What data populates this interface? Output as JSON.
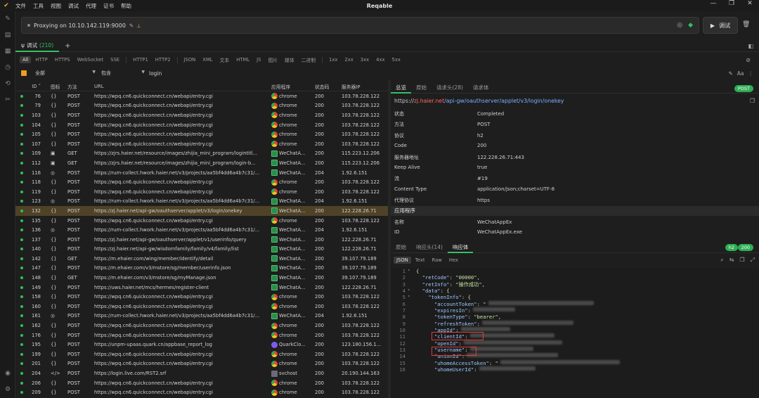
{
  "window": {
    "title": "Reqable",
    "menu": [
      "文件",
      "工具",
      "视图",
      "调试",
      "代理",
      "证书",
      "帮助"
    ]
  },
  "proxy": {
    "status": "Proxying on 10.10.142.119:9000",
    "debug_label": "调试"
  },
  "session_tab": {
    "label": "调试",
    "count": "(210)"
  },
  "filters": [
    "All",
    "HTTP",
    "HTTPS",
    "WebSocket",
    "SSE",
    "HTTP1",
    "HTTP2",
    "JSON",
    "XML",
    "文本",
    "HTML",
    "JS",
    "图片",
    "媒体",
    "二进制",
    "1xx",
    "2xx",
    "3xx",
    "4xx",
    "5xx"
  ],
  "search": {
    "scope": "全部",
    "mode": "包含",
    "keyword": "login"
  },
  "table": {
    "headers": {
      "id": "ID",
      "icon": "图标",
      "method": "方法",
      "url": "URL",
      "app": "应用程序",
      "status": "状态码",
      "ip": "服务器IP"
    },
    "selected_id": "132",
    "rows": [
      {
        "id": "76",
        "icon": "{}",
        "method": "POST",
        "url": "https://wpq.cn6.quickconnect.cn/webapi/entry.cgi",
        "app": "chrome",
        "appType": "chrome",
        "status": "200",
        "ip": "103.78.228.122"
      },
      {
        "id": "79",
        "icon": "{}",
        "method": "POST",
        "url": "https://wpq.cn6.quickconnect.cn/webapi/entry.cgi",
        "app": "chrome",
        "appType": "chrome",
        "status": "200",
        "ip": "103.78.228.122"
      },
      {
        "id": "103",
        "icon": "{}",
        "method": "POST",
        "url": "https://wpq.cn6.quickconnect.cn/webapi/entry.cgi",
        "app": "chrome",
        "appType": "chrome",
        "status": "200",
        "ip": "103.78.228.122"
      },
      {
        "id": "104",
        "icon": "{}",
        "method": "POST",
        "url": "https://wpq.cn6.quickconnect.cn/webapi/entry.cgi",
        "app": "chrome",
        "appType": "chrome",
        "status": "200",
        "ip": "103.78.228.122"
      },
      {
        "id": "105",
        "icon": "{}",
        "method": "POST",
        "url": "https://wpq.cn6.quickconnect.cn/webapi/entry.cgi",
        "app": "chrome",
        "appType": "chrome",
        "status": "200",
        "ip": "103.78.228.122"
      },
      {
        "id": "107",
        "icon": "{}",
        "method": "POST",
        "url": "https://wpq.cn6.quickconnect.cn/webapi/entry.cgi",
        "app": "chrome",
        "appType": "chrome",
        "status": "200",
        "ip": "103.78.228.122"
      },
      {
        "id": "109",
        "icon": "▣",
        "method": "GET",
        "url": "https://zjrs.haier.net/resource/images/zhijia_mini_program/logintitl...",
        "app": "WeChatA...",
        "appType": "wechat",
        "status": "200",
        "ip": "115.223.12.206"
      },
      {
        "id": "112",
        "icon": "▣",
        "method": "GET",
        "url": "https://zjrs.haier.net/resource/images/zhijia_mini_program/login-b...",
        "app": "WeChatA...",
        "appType": "wechat",
        "status": "200",
        "ip": "115.223.12.206"
      },
      {
        "id": "116",
        "icon": "◎",
        "method": "POST",
        "url": "https://rum-collect.hwork.haier.net/v3/projects/aa5bf4dd6a4b7c31/...",
        "app": "WeChatA...",
        "appType": "wechat",
        "status": "204",
        "ip": "1.92.6.151"
      },
      {
        "id": "118",
        "icon": "{}",
        "method": "POST",
        "url": "https://wpq.cn6.quickconnect.cn/webapi/entry.cgi",
        "app": "chrome",
        "appType": "chrome",
        "status": "200",
        "ip": "103.78.228.122"
      },
      {
        "id": "119",
        "icon": "{}",
        "method": "POST",
        "url": "https://wpq.cn6.quickconnect.cn/webapi/entry.cgi",
        "app": "chrome",
        "appType": "chrome",
        "status": "200",
        "ip": "103.78.228.122"
      },
      {
        "id": "123",
        "icon": "◎",
        "method": "POST",
        "url": "https://rum-collect.hwork.haier.net/v3/projects/aa5bf4dd6a4b7c31/...",
        "app": "WeChatA...",
        "appType": "wechat",
        "status": "204",
        "ip": "1.92.6.151"
      },
      {
        "id": "132",
        "icon": "{}",
        "method": "POST",
        "url": "https://zj.haier.net/api-gw/oauthserver/applet/v3/login/onekey",
        "app": "WeChatA...",
        "appType": "wechat",
        "status": "200",
        "ip": "122.228.26.71"
      },
      {
        "id": "135",
        "icon": "{}",
        "method": "POST",
        "url": "https://wpq.cn6.quickconnect.cn/webapi/entry.cgi",
        "app": "chrome",
        "appType": "chrome",
        "status": "200",
        "ip": "103.78.228.122"
      },
      {
        "id": "136",
        "icon": "◎",
        "method": "POST",
        "url": "https://rum-collect.hwork.haier.net/v3/projects/aa5bf4dd6a4b7c31/...",
        "app": "WeChatA...",
        "appType": "wechat",
        "status": "204",
        "ip": "1.92.6.151"
      },
      {
        "id": "137",
        "icon": "{}",
        "method": "POST",
        "url": "https://zj.haier.net/api-gw/oauthserver/applet/v1/userinfo/query",
        "app": "WeChatA...",
        "appType": "wechat",
        "status": "200",
        "ip": "122.228.26.71"
      },
      {
        "id": "140",
        "icon": "{}",
        "method": "POST",
        "url": "https://zj.haier.net/api-gw/wisdomfamily/family/v4/family/list",
        "app": "WeChatA...",
        "appType": "wechat",
        "status": "200",
        "ip": "122.228.26.71"
      },
      {
        "id": "142",
        "icon": "{}",
        "method": "GET",
        "url": "https://m.ehaier.com/wing/member/identify/detail",
        "app": "WeChatA...",
        "appType": "wechat",
        "status": "200",
        "ip": "39.107.79.189"
      },
      {
        "id": "147",
        "icon": "{}",
        "method": "POST",
        "url": "https://m.ehaier.com/v3/mstore/sg/member/userinfo.json",
        "app": "WeChatA...",
        "appType": "wechat",
        "status": "200",
        "ip": "39.107.79.189"
      },
      {
        "id": "148",
        "icon": "{}",
        "method": "GET",
        "url": "https://m.ehaier.com/v3/mstore/sg/myManage.json",
        "app": "WeChatA...",
        "appType": "wechat",
        "status": "200",
        "ip": "39.107.79.189"
      },
      {
        "id": "149",
        "icon": "{}",
        "method": "POST",
        "url": "https://uws.haier.net/mcs/hermes/register-client",
        "app": "WeChatA...",
        "appType": "wechat",
        "status": "200",
        "ip": "122.228.26.71"
      },
      {
        "id": "158",
        "icon": "{}",
        "method": "POST",
        "url": "https://wpq.cn6.quickconnect.cn/webapi/entry.cgi",
        "app": "chrome",
        "appType": "chrome",
        "status": "200",
        "ip": "103.78.228.122"
      },
      {
        "id": "160",
        "icon": "{}",
        "method": "POST",
        "url": "https://wpq.cn6.quickconnect.cn/webapi/entry.cgi",
        "app": "chrome",
        "appType": "chrome",
        "status": "200",
        "ip": "103.78.228.122"
      },
      {
        "id": "161",
        "icon": "◎",
        "method": "POST",
        "url": "https://rum-collect.hwork.haier.net/v3/projects/aa5bf4dd6a4b7c31/...",
        "app": "WeChatA...",
        "appType": "wechat",
        "status": "204",
        "ip": "1.92.6.151"
      },
      {
        "id": "162",
        "icon": "{}",
        "method": "POST",
        "url": "https://wpq.cn6.quickconnect.cn/webapi/entry.cgi",
        "app": "chrome",
        "appType": "chrome",
        "status": "200",
        "ip": "103.78.228.122"
      },
      {
        "id": "176",
        "icon": "{}",
        "method": "POST",
        "url": "https://wpq.cn6.quickconnect.cn/webapi/entry.cgi",
        "app": "chrome",
        "appType": "chrome",
        "status": "200",
        "ip": "103.78.228.122"
      },
      {
        "id": "195",
        "icon": "{}",
        "method": "POST",
        "url": "https://unpm-upaas.quark.cn/appbase_report_log",
        "app": "QuarkClo...",
        "appType": "quark",
        "status": "200",
        "ip": "123.180.156.1..."
      },
      {
        "id": "199",
        "icon": "{}",
        "method": "POST",
        "url": "https://wpq.cn6.quickconnect.cn/webapi/entry.cgi",
        "app": "chrome",
        "appType": "chrome",
        "status": "200",
        "ip": "103.78.228.122"
      },
      {
        "id": "201",
        "icon": "{}",
        "method": "POST",
        "url": "https://wpq.cn6.quickconnect.cn/webapi/entry.cgi",
        "app": "chrome",
        "appType": "chrome",
        "status": "200",
        "ip": "103.78.228.122"
      },
      {
        "id": "204",
        "icon": "</>",
        "method": "POST",
        "url": "https://login.live.com/RST2.srf",
        "app": "svchost",
        "appType": "svc",
        "status": "200",
        "ip": "20.190.144.163"
      },
      {
        "id": "206",
        "icon": "{}",
        "method": "POST",
        "url": "https://wpq.cn6.quickconnect.cn/webapi/entry.cgi",
        "app": "chrome",
        "appType": "chrome",
        "status": "200",
        "ip": "103.78.228.122"
      },
      {
        "id": "209",
        "icon": "{}",
        "method": "POST",
        "url": "https://wpq.cn6.quickconnect.cn/webapi/entry.cgi",
        "app": "chrome",
        "appType": "chrome",
        "status": "200",
        "ip": "103.78.228.122"
      }
    ]
  },
  "detail": {
    "tabs": [
      "总览",
      "原始",
      "请求头(28)",
      "请求体"
    ],
    "method_badge": "POST",
    "request_url": {
      "proto": "https://",
      "host": "zj.haier.net",
      "path": "/api-gw/oauthserver/applet/v3/login/onekey"
    },
    "fields": [
      {
        "k": "状态",
        "v": "Completed"
      },
      {
        "k": "方法",
        "v": "POST"
      },
      {
        "k": "协议",
        "v": "h2"
      },
      {
        "k": "Code",
        "v": "200"
      },
      {
        "k": "服务器地址",
        "v": "122.228.26.71:443"
      },
      {
        "k": "Keep Alive",
        "v": "true"
      },
      {
        "k": "流",
        "v": "#19"
      },
      {
        "k": "Content Type",
        "v": "application/json;charset=UTF-8"
      },
      {
        "k": "代理协议",
        "v": "https"
      }
    ],
    "app_section": "应用程序",
    "app_fields": [
      {
        "k": "名称",
        "v": "WeChatAppEx"
      },
      {
        "k": "ID",
        "v": "WeChatAppEx.exe"
      }
    ]
  },
  "response": {
    "tabs": [
      "原始",
      "响应头(14)",
      "响应体"
    ],
    "badges": [
      "h2",
      "200"
    ],
    "formats": [
      "JSON",
      "Text",
      "Raw",
      "Hex"
    ],
    "lines": [
      {
        "n": "1",
        "fold": "▾",
        "indent": "",
        "key": "",
        "val": "{",
        "blur": 0
      },
      {
        "n": "2",
        "fold": "",
        "indent": "  ",
        "key": "\"retCode\"",
        "val": ": \"00000\",",
        "blur": 0
      },
      {
        "n": "3",
        "fold": "",
        "indent": "  ",
        "key": "\"retInfo\"",
        "val": ": \"操作成功\",",
        "blur": 0
      },
      {
        "n": "4",
        "fold": "▾",
        "indent": "  ",
        "key": "\"data\"",
        "val": ": {",
        "blur": 0
      },
      {
        "n": "5",
        "fold": "▾",
        "indent": "    ",
        "key": "\"tokenInfo\"",
        "val": ": {",
        "blur": 0
      },
      {
        "n": "6",
        "fold": "",
        "indent": "      ",
        "key": "\"accountToken\"",
        "val": ": \"",
        "blur": 150
      },
      {
        "n": "7",
        "fold": "",
        "indent": "      ",
        "key": "\"expiresIn\"",
        "val": ":",
        "blur": 60
      },
      {
        "n": "8",
        "fold": "",
        "indent": "      ",
        "key": "\"tokenType\"",
        "val": ": \"bearer\",",
        "blur": 0
      },
      {
        "n": "9",
        "fold": "",
        "indent": "      ",
        "key": "\"refreshToken\"",
        "val": ":",
        "blur": 130
      },
      {
        "n": "10",
        "fold": "",
        "indent": "      ",
        "key": "\"appId\"",
        "val": ":",
        "blur": 70
      },
      {
        "n": "11",
        "fold": "",
        "indent": "      ",
        "key": "\"clientId\"",
        "val": ":",
        "blur": 120
      },
      {
        "n": "12",
        "fold": "",
        "indent": "      ",
        "key": "\"openId\"",
        "val": ":",
        "blur": 140
      },
      {
        "n": "13",
        "fold": "",
        "indent": "      ",
        "key": "\"username\"",
        "val": ":",
        "blur": 90
      },
      {
        "n": "14",
        "fold": "",
        "indent": "      ",
        "key": "\"unionId\"",
        "val": ":",
        "blur": 130
      },
      {
        "n": "15",
        "fold": "",
        "indent": "      ",
        "key": "\"uhomeAccessToken\"",
        "val": ": \"",
        "blur": 170
      },
      {
        "n": "16",
        "fold": "",
        "indent": "      ",
        "key": "\"uhomeUserId\"",
        "val": ":",
        "blur": 80
      }
    ]
  }
}
